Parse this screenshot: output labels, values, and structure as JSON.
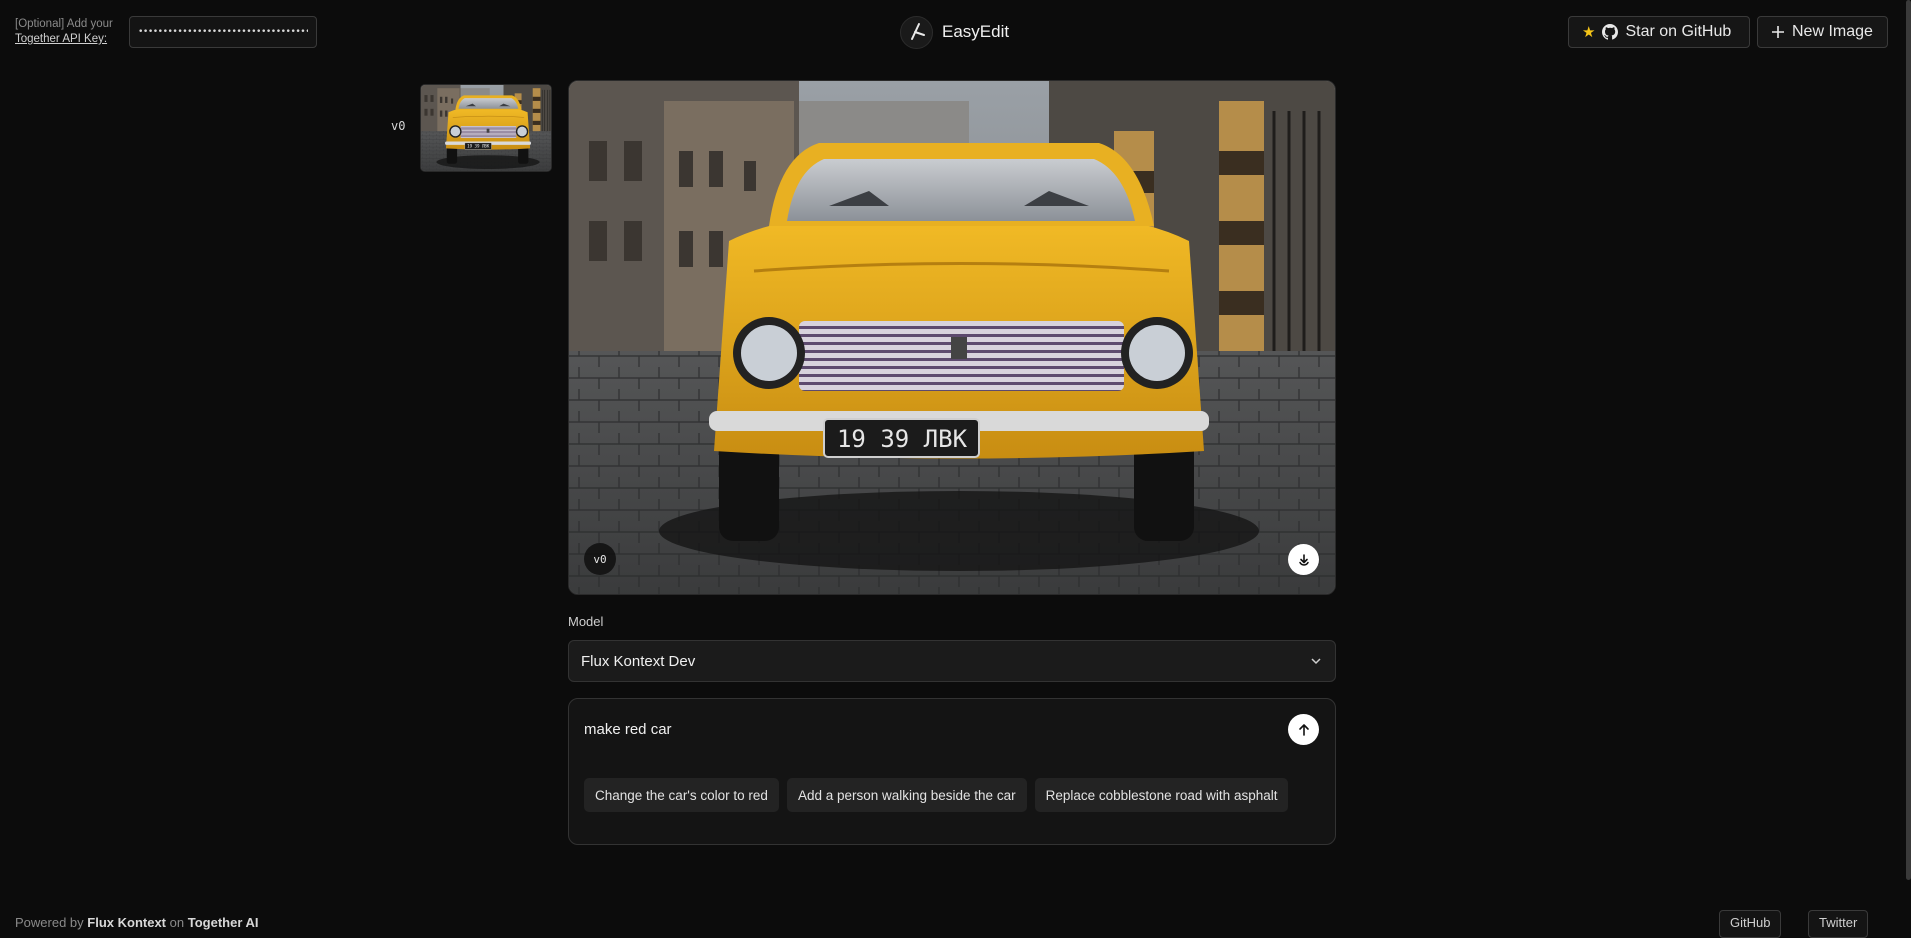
{
  "header": {
    "api_key": {
      "label_prefix": "[Optional] Add your",
      "label_link": "Together API Key:",
      "value": "••••••••••••••••••••••••••••••••••••••••••"
    },
    "brand": {
      "name": "EasyEdit",
      "icon": "logo-icon"
    },
    "star_button": {
      "label": "Star on GitHub",
      "icons": [
        "star-icon",
        "github-icon"
      ]
    },
    "new_image_button": {
      "label": "New Image",
      "icon": "plus-icon"
    }
  },
  "history": {
    "items": [
      {
        "label": "v0"
      }
    ]
  },
  "main_image": {
    "version": "v0",
    "plate_text": "19 39 ЛВК",
    "download_icon": "download-icon"
  },
  "model": {
    "label": "Model",
    "selected": "Flux Kontext Dev"
  },
  "prompt": {
    "value": "make red car",
    "suggestions": [
      "Change the car's color to red",
      "Add a person walking beside the car",
      "Replace cobblestone road with asphalt"
    ]
  },
  "footer": {
    "prefix": "Powered by",
    "model": "Flux Kontext",
    "mid": "on",
    "provider": "Together AI",
    "github": "GitHub",
    "twitter": "Twitter"
  },
  "colors": {
    "background": "#0c0c0c",
    "car_yellow": "#e0a61c",
    "star": "#f5c518"
  }
}
